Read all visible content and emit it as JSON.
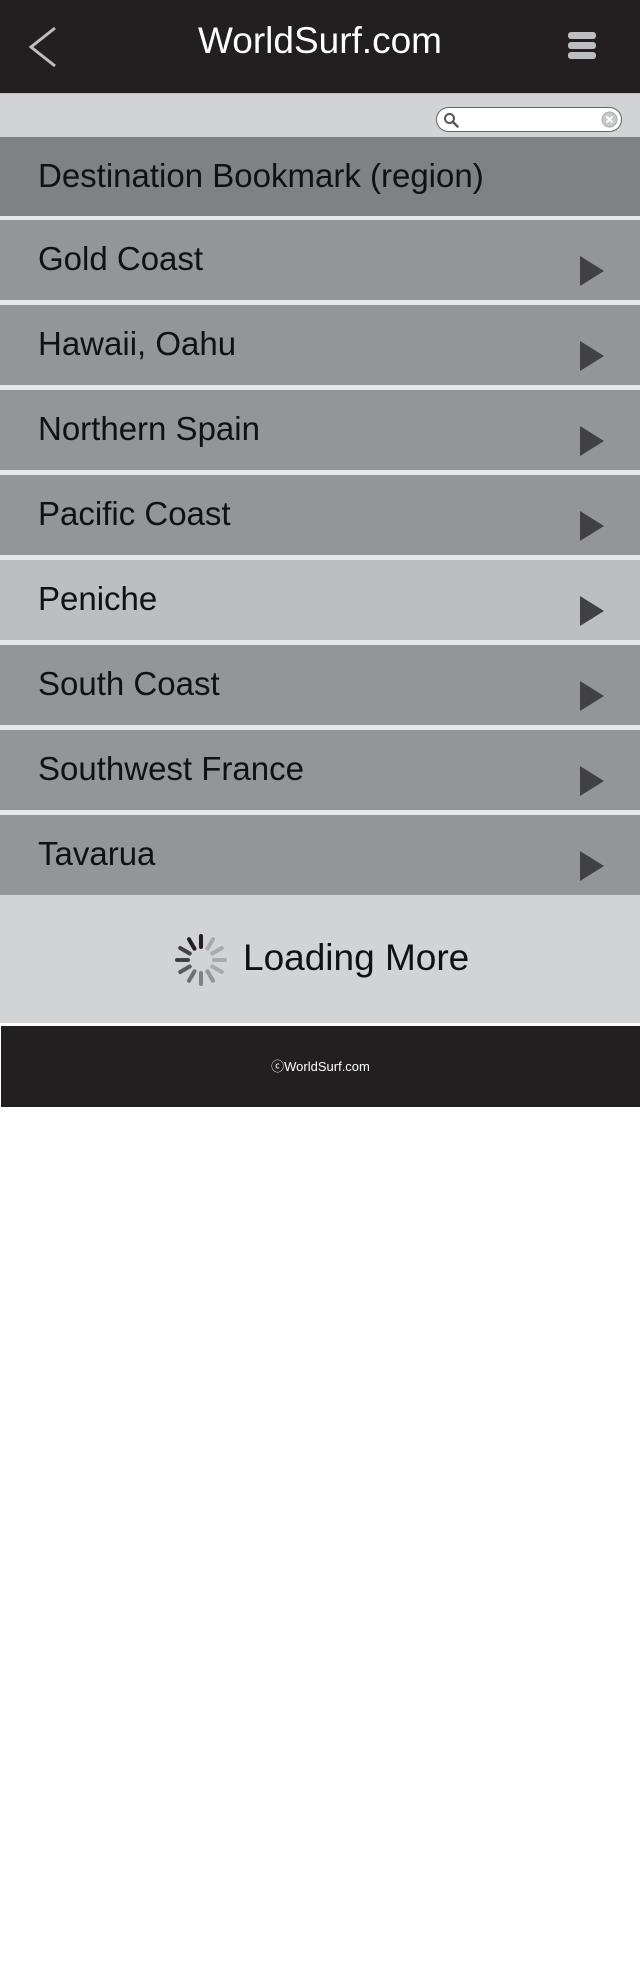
{
  "header": {
    "title": "WorldSurf.com",
    "back_icon": "chevron-left-icon",
    "menu_icon": "hamburger-menu-icon"
  },
  "search": {
    "placeholder": "",
    "value": "",
    "search_icon": "search-icon",
    "clear_icon": "clear-icon"
  },
  "list": {
    "section_title": "Destination Bookmark (region)",
    "items": [
      {
        "label": "Gold Coast"
      },
      {
        "label": "Hawaii, Oahu"
      },
      {
        "label": "Northern Spain"
      },
      {
        "label": "Pacific Coast"
      },
      {
        "label": "Peniche",
        "highlighted": true
      },
      {
        "label": "South Coast"
      },
      {
        "label": "Southwest France"
      },
      {
        "label": "Tavarua"
      }
    ]
  },
  "loading": {
    "text": "Loading More"
  },
  "footer": {
    "copyright_symbol": "ⓒ",
    "copyright_text": "WorldSurf.com"
  },
  "colors": {
    "header_bg": "#231f20",
    "section_bg": "#808184",
    "row_bg": "#939598",
    "row_highlight_bg": "#bcbec0",
    "bar_bg": "#d2d3d5"
  }
}
